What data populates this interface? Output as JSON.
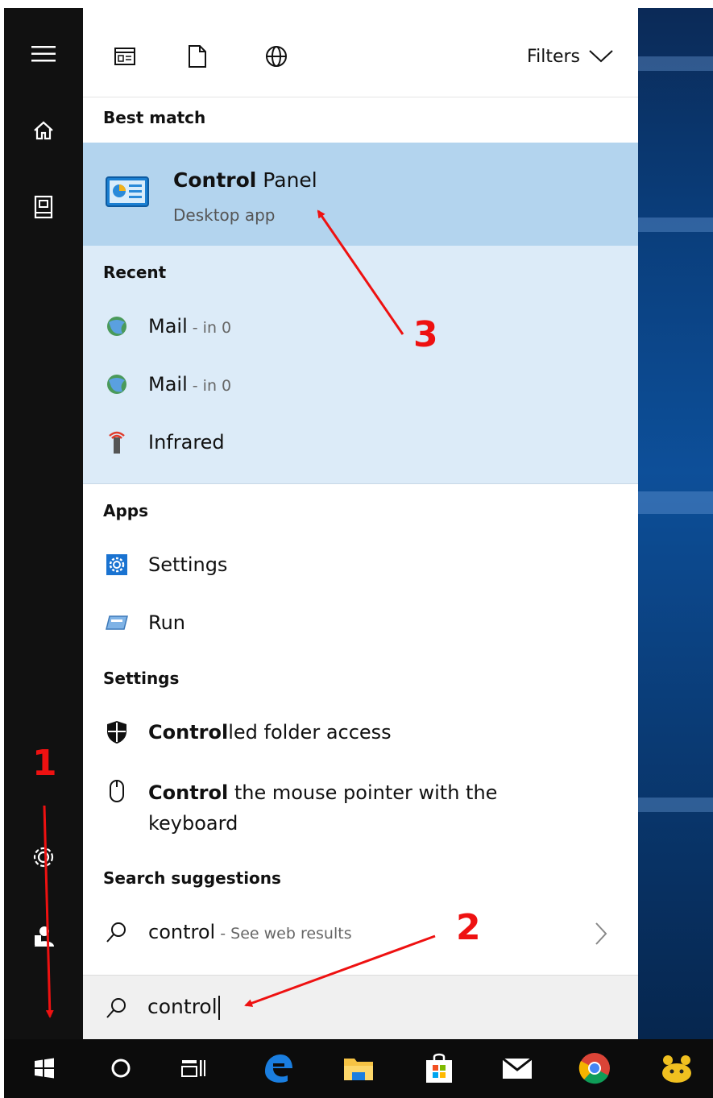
{
  "filters_label": "Filters",
  "best_match": {
    "header": "Best match",
    "title_bold": "Control",
    "title_rest": " Panel",
    "subtitle": "Desktop app"
  },
  "recent": {
    "header": "Recent",
    "items": [
      {
        "label": "Mail",
        "suffix": " - in 0"
      },
      {
        "label": "Mail",
        "suffix": " - in 0"
      },
      {
        "label": "Infrared",
        "suffix": ""
      }
    ]
  },
  "apps": {
    "header": "Apps",
    "items": [
      {
        "label": "Settings"
      },
      {
        "label": "Run"
      }
    ]
  },
  "settings": {
    "header": "Settings",
    "item1_bold": "Control",
    "item1_rest": "led folder access",
    "item2_bold": "Control",
    "item2_rest_line1": " the mouse pointer with the",
    "item2_line2": "keyboard"
  },
  "suggestions": {
    "header": "Search suggestions",
    "query": "control",
    "suffix": " - See web results"
  },
  "search": {
    "value": "control"
  },
  "annotations": [
    "1",
    "2",
    "3"
  ],
  "colors": {
    "highlight": "#b3d4ee",
    "recent_bg": "#dcebf8",
    "annotation": "#ee1111"
  }
}
